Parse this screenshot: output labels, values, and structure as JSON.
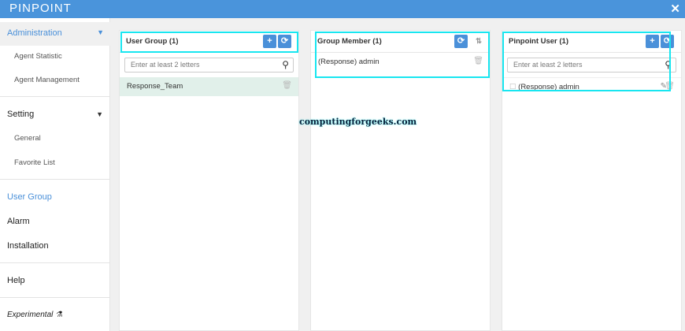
{
  "header": {
    "logo": "PINPOINT",
    "close": "✕"
  },
  "sidebar": {
    "administration": "Administration",
    "admin_items": [
      "Agent Statistic",
      "Agent Management"
    ],
    "setting": "Setting",
    "setting_items": [
      "General",
      "Favorite List"
    ],
    "user_group": "User Group",
    "alarm": "Alarm",
    "installation": "Installation",
    "help": "Help",
    "experimental": "Experimental"
  },
  "panels": {
    "user_group": {
      "title": "User Group (1)",
      "placeholder": "Enter at least 2 letters",
      "items": [
        "Response_Team"
      ]
    },
    "group_member": {
      "title": "Group Member (1)",
      "items": [
        "(Response) admin"
      ]
    },
    "pinpoint_user": {
      "title": "Pinpoint User (1)",
      "placeholder": "Enter at least 2 letters",
      "items": [
        "(Response) admin"
      ]
    }
  },
  "watermark": "computingforgeeks.com"
}
